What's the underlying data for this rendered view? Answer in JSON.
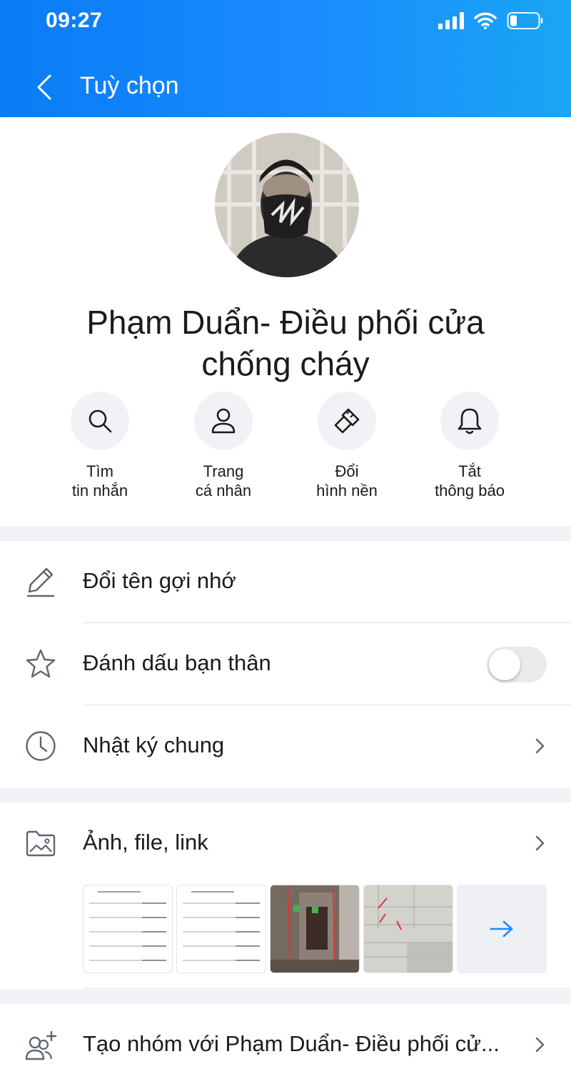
{
  "status_bar": {
    "time": "09:27"
  },
  "nav": {
    "title": "Tuỳ chọn"
  },
  "profile": {
    "name": "Phạm Duẩn- Điều phối cửa chống cháy"
  },
  "quick_actions": [
    {
      "icon": "search-icon",
      "line1": "Tìm",
      "line2": "tin nhắn"
    },
    {
      "icon": "person-icon",
      "line1": "Trang",
      "line2": "cá nhân"
    },
    {
      "icon": "paint-brush-icon",
      "line1": "Đổi",
      "line2": "hình nền"
    },
    {
      "icon": "bell-icon",
      "line1": "Tắt",
      "line2": "thông báo"
    }
  ],
  "settings": {
    "rename": {
      "label": "Đổi tên gợi nhớ",
      "icon": "pencil-icon"
    },
    "best_friend": {
      "label": "Đánh dấu bạn thân",
      "icon": "star-icon",
      "enabled": false
    },
    "timeline": {
      "label": "Nhật ký chung",
      "icon": "clock-icon"
    },
    "media": {
      "label": "Ảnh, file, link",
      "icon": "image-folder-icon"
    },
    "create_group": {
      "label": "Tạo nhóm với Phạm Duẩn- Điều phối cử...",
      "icon": "add-group-icon"
    }
  },
  "colors": {
    "header": "#1a8cff",
    "accent": "#0a7cf5",
    "separator": "#f0f2f5"
  }
}
